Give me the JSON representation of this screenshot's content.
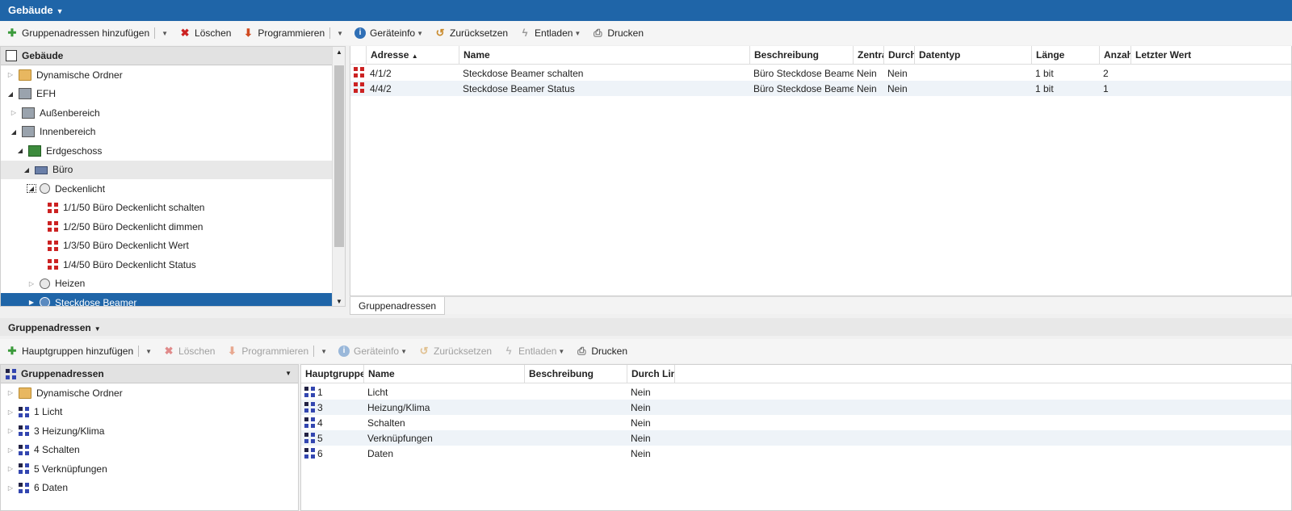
{
  "top": {
    "title": "Gebäude",
    "toolbar": {
      "add": "Gruppenadressen hinzufügen",
      "delete": "Löschen",
      "program": "Programmieren",
      "info": "Geräteinfo",
      "reset": "Zurücksetzen",
      "unload": "Entladen",
      "print": "Drucken"
    },
    "tree": {
      "header": "Gebäude",
      "items": [
        "Dynamische Ordner",
        "EFH",
        "Außenbereich",
        "Innenbereich",
        "Erdgeschoss",
        "Büro",
        "Deckenlicht",
        "1/1/50 Büro Deckenlicht schalten",
        "1/2/50 Büro Deckenlicht dimmen",
        "1/3/50 Büro Deckenlicht Wert",
        "1/4/50 Büro Deckenlicht Status",
        "Heizen",
        "Steckdose Beamer"
      ]
    },
    "grid": {
      "columns": [
        "Adresse",
        "Name",
        "Beschreibung",
        "Zentral",
        "Durch",
        "Datentyp",
        "Länge",
        "Anzahl",
        "Letzter Wert"
      ],
      "rows": [
        [
          "4/1/2",
          "Steckdose Beamer schalten",
          "Büro Steckdose Beamer",
          "Nein",
          "Nein",
          "",
          "1 bit",
          "2",
          ""
        ],
        [
          "4/4/2",
          "Steckdose Beamer Status",
          "Büro Steckdose Beamer",
          "Nein",
          "Nein",
          "",
          "1 bit",
          "1",
          ""
        ]
      ]
    },
    "tab": "Gruppenadressen"
  },
  "bottom": {
    "title": "Gruppenadressen",
    "toolbar": {
      "add": "Hauptgruppen hinzufügen",
      "delete": "Löschen",
      "program": "Programmieren",
      "info": "Geräteinfo",
      "reset": "Zurücksetzen",
      "unload": "Entladen",
      "print": "Drucken"
    },
    "tree": {
      "header": "Gruppenadressen",
      "items": [
        "Dynamische Ordner",
        "1 Licht",
        "3 Heizung/Klima",
        "4 Schalten",
        "5 Verknüpfungen",
        "6 Daten"
      ]
    },
    "grid": {
      "columns": [
        "Hauptgruppe",
        "Name",
        "Beschreibung",
        "Durch Linie"
      ],
      "rows": [
        [
          "1",
          "Licht",
          "",
          "Nein"
        ],
        [
          "3",
          "Heizung/Klima",
          "",
          "Nein"
        ],
        [
          "4",
          "Schalten",
          "",
          "Nein"
        ],
        [
          "5",
          "Verknüpfungen",
          "",
          "Nein"
        ],
        [
          "6",
          "Daten",
          "",
          "Nein"
        ]
      ]
    }
  }
}
